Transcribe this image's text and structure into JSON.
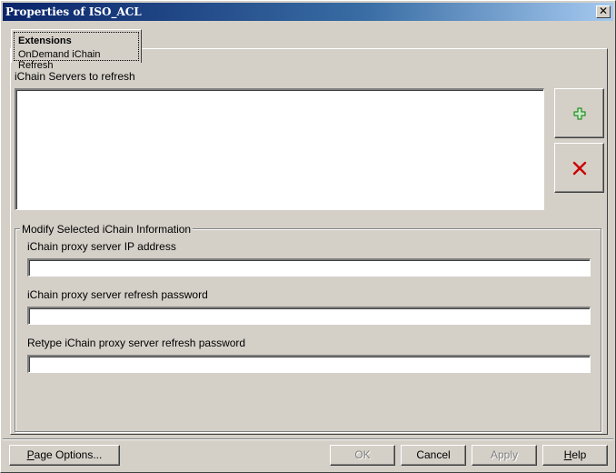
{
  "window": {
    "title": "Properties of ISO_ACL",
    "close_glyph": "✕"
  },
  "tab": {
    "title": "Extensions",
    "subtitle": "OnDemand iChain Refresh"
  },
  "servers": {
    "label": "iChain Servers to refresh",
    "items": []
  },
  "side_buttons": {
    "add_icon": "plus-icon",
    "remove_icon": "delete-x-icon",
    "add_color": "#008000",
    "remove_color": "#cc0000"
  },
  "group": {
    "legend": "Modify Selected iChain Information",
    "fields": [
      {
        "label": "iChain proxy server IP address",
        "value": ""
      },
      {
        "label": "iChain proxy server refresh password",
        "value": ""
      },
      {
        "label": "Retype iChain proxy server refresh password",
        "value": ""
      }
    ]
  },
  "footer": {
    "page_options_first": "P",
    "page_options_rest": "age Options...",
    "ok": "OK",
    "cancel": "Cancel",
    "apply": "Apply",
    "help_first": "H",
    "help_rest": "elp"
  }
}
